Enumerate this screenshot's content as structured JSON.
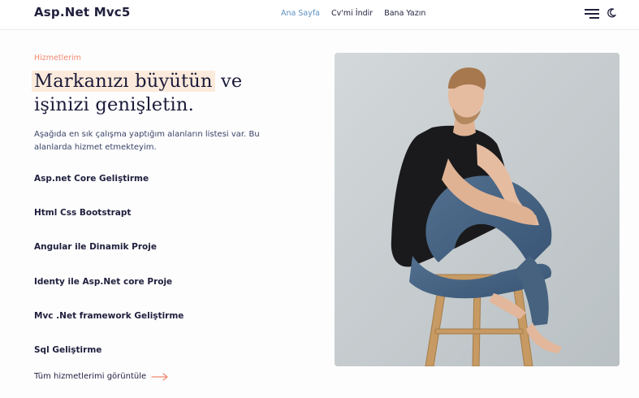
{
  "header": {
    "brand": "Asp.Net Mvc5",
    "nav": [
      {
        "label": "Ana Sayfa",
        "active": true
      },
      {
        "label": "Cv'mi İndir",
        "active": false
      },
      {
        "label": "Bana Yazın",
        "active": false
      }
    ],
    "icons": {
      "menu": "hamburger-menu-icon",
      "theme": "moon-icon"
    }
  },
  "main": {
    "eyebrow": "Hizmetlerim",
    "headline_highlight": "Markanızı büyütün",
    "headline_rest": " ve işinizi genişletin.",
    "intro": "Aşağıda en sık çalışma yaptığım alanların listesi var. Bu alanlarda hizmet etmekteyim.",
    "services": [
      "Asp.net Core Geliştirme",
      "Html Css Bootstrapt",
      "Angular ile Dinamik Proje",
      "Identy ile Asp.Net core Proje",
      "Mvc .Net framework Geliştirme",
      "Sql Geliştirme"
    ],
    "view_all": "Tüm hizmetlerimi görüntüle",
    "view_all_icon": "arrow-right-icon"
  },
  "colors": {
    "accent": "#f2896e",
    "highlight": "#fcebdc",
    "nav_active": "#5d8fc2",
    "text_dark": "#1f1f3d"
  }
}
